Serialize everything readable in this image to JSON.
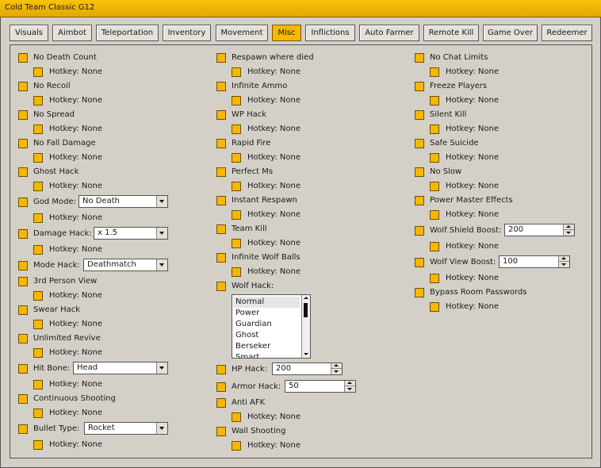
{
  "window": {
    "title": "Cold Team Classic G12"
  },
  "tabs": [
    "Visuals",
    "Aimbot",
    "Teleportation",
    "Inventory",
    "Movement",
    "Misc",
    "Inflictions",
    "Auto Farmer",
    "Remote Kill",
    "Game Over",
    "Redeemer"
  ],
  "active_tab": "Misc",
  "hotkey_label": "Hotkey: None",
  "col1": {
    "no_death_count": "No Death Count",
    "no_recoil": "No Recoil",
    "no_spread": "No Spread",
    "no_fall_damage": "No Fall Damage",
    "ghost_hack": "Ghost Hack",
    "god_mode": "God Mode:",
    "god_mode_value": "No Death",
    "damage_hack": "Damage Hack:",
    "damage_hack_value": "x 1.5",
    "mode_hack": "Mode Hack:",
    "mode_hack_value": "Deathmatch",
    "third_person_view": "3rd Person View",
    "swear_hack": "Swear Hack",
    "unlimited_revive": "Unlimited Revive",
    "hit_bone": "Hit Bone:",
    "hit_bone_value": "Head",
    "continuous_shooting": "Continuous Shooting",
    "bullet_type": "Bullet Type:",
    "bullet_type_value": "Rocket"
  },
  "col2": {
    "respawn_where_died": "Respawn where died",
    "infinite_ammo": "Infinite Ammo",
    "wp_hack": "WP Hack",
    "rapid_fire": "Rapid Fire",
    "perfect_ms": "Perfect Ms",
    "instant_respawn": "Instant Respawn",
    "team_kill": "Team Kill",
    "infinite_wolf_balls": "Infinite Wolf Balls",
    "wolf_hack": "Wolf Hack:",
    "wolf_hack_options": [
      "Normal",
      "Power",
      "Guardian",
      "Ghost",
      "Berseker",
      "Smart"
    ],
    "wolf_hack_selected": "Normal",
    "hp_hack": "HP Hack:",
    "hp_hack_value": "200",
    "armor_hack": "Armor Hack:",
    "armor_hack_value": "50",
    "anti_afk": "Anti AFK",
    "wall_shooting": "Wall Shooting"
  },
  "col3": {
    "no_chat_limits": "No Chat Limits",
    "freeze_players": "Freeze Players",
    "silent_kill": "Silent Kill",
    "safe_suicide": "Safe Suicide",
    "no_slow": "No Slow",
    "power_master_effects": "Power Master Effects",
    "wolf_shield_boost": "Wolf Shield Boost:",
    "wolf_shield_boost_value": "200",
    "wolf_view_boost": "Wolf View Boost:",
    "wolf_view_boost_value": "100",
    "bypass_room_passwords": "Bypass Room Passwords"
  },
  "colors": {
    "accent": "#f5b800",
    "title_bar": "#f0b400",
    "background": "#d4d0c8"
  }
}
